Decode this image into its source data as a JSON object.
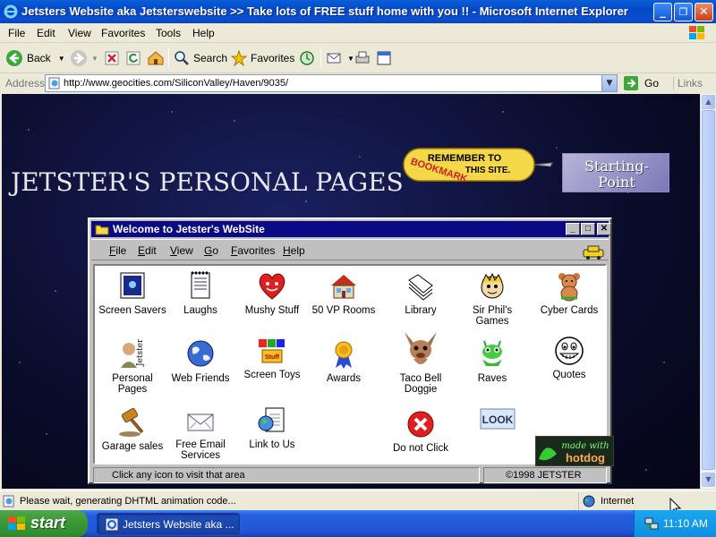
{
  "window": {
    "title": "Jetsters Website aka Jetsterswebsite >> Take lots of FREE stuff home with you !! - Microsoft Internet Explorer",
    "minimize": "_",
    "maximize": "❐",
    "close": "✕"
  },
  "menu": [
    "File",
    "Edit",
    "View",
    "Favorites",
    "Tools",
    "Help"
  ],
  "toolbar": {
    "back": "Back",
    "search": "Search",
    "favorites": "Favorites"
  },
  "address": {
    "label": "Address",
    "url": "http://www.geocities.com/SiliconValley/Haven/9035/",
    "go": "Go",
    "links": "Links"
  },
  "page": {
    "heading": "JETSTER'S PERSONAL PAGES",
    "bookmark_line1": "REMEMBER TO",
    "bookmark_line2": "THIS SITE.",
    "bookmark_word": "BOOKMARK",
    "starting_point_1": "Starting-",
    "starting_point_2": "Point",
    "embedded_window": {
      "title": "Welcome to Jetster's WebSite",
      "menu": [
        "File",
        "Edit",
        "View",
        "Go",
        "Favorites",
        "Help"
      ],
      "icons": [
        {
          "label": "Screen Savers",
          "icon": "screen-savers-icon"
        },
        {
          "label": "Laughs",
          "icon": "notepad-icon"
        },
        {
          "label": "Mushy Stuff",
          "icon": "heart-icon"
        },
        {
          "label": "50 VP Rooms",
          "icon": "house-icon"
        },
        {
          "label": "Library",
          "icon": "books-icon"
        },
        {
          "label": "Sir Phil's Games",
          "icon": "cartoon-face-icon"
        },
        {
          "label": "Cyber Cards",
          "icon": "teddy-bear-icon"
        },
        {
          "label": "Personal Pages",
          "icon": "person-icon"
        },
        {
          "label": "Web Friends",
          "icon": "globe-icon"
        },
        {
          "label": "Screen Toys",
          "icon": "toys-icon"
        },
        {
          "label": "Awards",
          "icon": "ribbon-icon"
        },
        {
          "label": "Taco Bell Doggie",
          "icon": "chihuahua-icon"
        },
        {
          "label": "Raves",
          "icon": "alien-icon"
        },
        {
          "label": "Quotes",
          "icon": "grin-face-icon"
        },
        {
          "label": "Garage sales",
          "icon": "gavel-icon"
        },
        {
          "label": "Free Email Services",
          "icon": "envelope-icon"
        },
        {
          "label": "Link to Us",
          "icon": "link-page-icon"
        },
        {
          "label": "Do not Click",
          "icon": "red-x-icon"
        },
        {
          "label": "LOOK",
          "icon": "look-button-icon"
        }
      ],
      "hotdog_line1": "made with",
      "hotdog_line2": "hotdog",
      "status_left": "Click any icon to visit that area",
      "status_right": "©1998 JETSTER"
    }
  },
  "statusbar": {
    "message": "Please wait, generating DHTML animation code...",
    "zone": "Internet"
  },
  "taskbar": {
    "start": "start",
    "task": "Jetsters Website aka ...",
    "clock": "11:10 AM"
  },
  "colors": {
    "titlebar": "#0348c8",
    "w98_title": "#0a0a84",
    "start_green": "#3b9a38",
    "tray_blue": "#0f8fe0"
  }
}
